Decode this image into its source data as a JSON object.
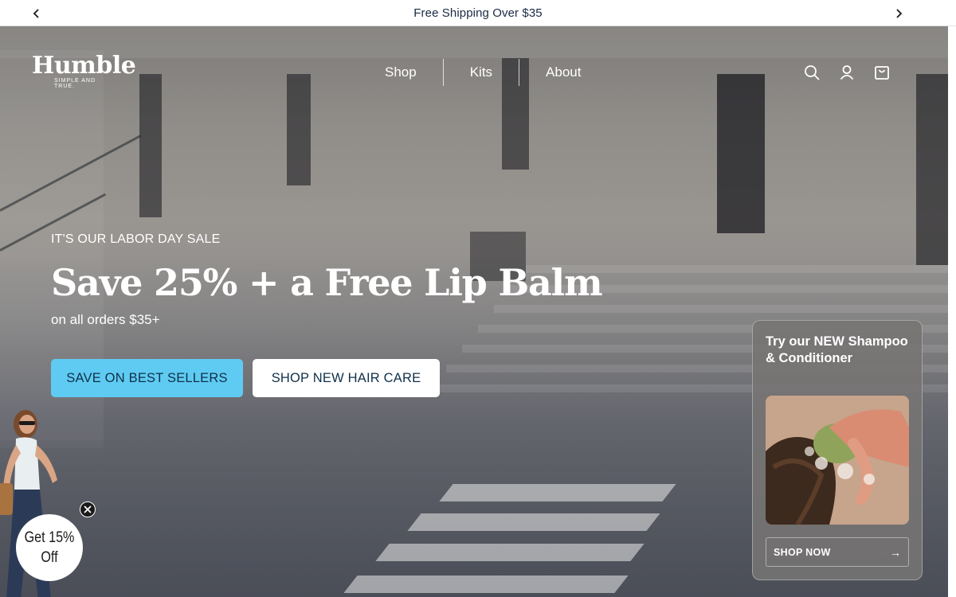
{
  "announcement": {
    "text": "Free Shipping Over $35",
    "prev_icon": "chevron-left-icon",
    "next_icon": "chevron-right-icon"
  },
  "header": {
    "logo_text": "Humble",
    "logo_tagline": "SIMPLE AND TRUE.",
    "nav": [
      {
        "label": "Shop"
      },
      {
        "label": "Kits"
      },
      {
        "label": "About"
      }
    ],
    "icons": [
      "search-icon",
      "account-icon",
      "cart-icon"
    ]
  },
  "hero": {
    "eyebrow": "IT'S OUR LABOR DAY SALE",
    "headline": "Save 25% + a Free Lip Balm",
    "subline": "on all orders $35+",
    "primary_button": "SAVE ON BEST SELLERS",
    "secondary_button": "SHOP NEW HAIR CARE"
  },
  "promo_card": {
    "title": "Try our NEW Shampoo & Conditioner",
    "button_label": "SHOP NOW",
    "button_arrow": "→"
  },
  "discount_popup": {
    "text": "Get 15% Off",
    "close_icon": "close-icon"
  },
  "colors": {
    "primary_button_bg": "#5fcbf2",
    "button_text": "#10304a",
    "announcement_text": "#1a2a44"
  }
}
